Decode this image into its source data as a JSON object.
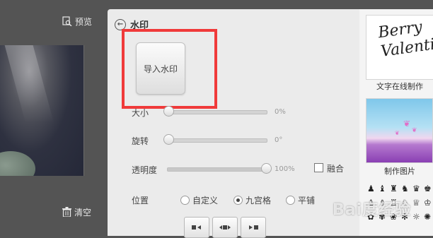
{
  "left": {
    "preview_label": "预览",
    "clear_label": "清空"
  },
  "panel": {
    "title": "水印",
    "import_button": "导入水印",
    "size": {
      "label": "大小",
      "value": "0%"
    },
    "rotate": {
      "label": "旋转",
      "value": "0°"
    },
    "opacity": {
      "label": "透明度",
      "value": "100%",
      "level": 1.0
    },
    "blend_label": "融合",
    "position": {
      "label": "位置",
      "options": [
        "自定义",
        "九宫格",
        "平铺"
      ],
      "selected": "九宫格"
    }
  },
  "templates": [
    {
      "label": "文字在线制作",
      "art_text": "Berry\nValentine"
    },
    {
      "label": "制作图片"
    }
  ],
  "icons": [
    "♟",
    "♝",
    "♜",
    "♞",
    "♛",
    "♚",
    "♙",
    "♗",
    "♖",
    "♘",
    "♕",
    "♔",
    "✿",
    "✾",
    "❀",
    "✻",
    "☼",
    "✺"
  ],
  "watermark_text": "Bai度经验"
}
